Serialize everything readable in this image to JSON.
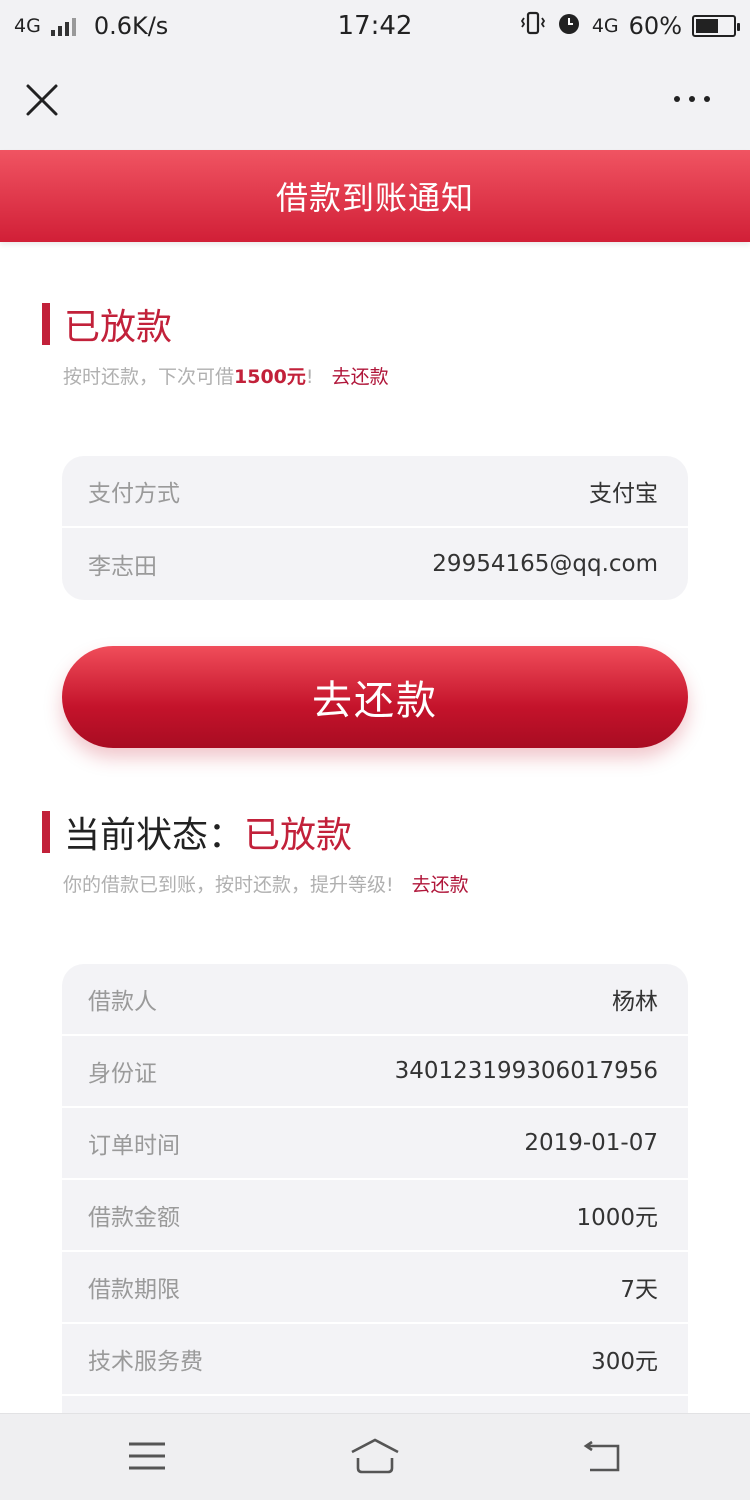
{
  "status_bar": {
    "network": "4G",
    "speed": "0.6K/s",
    "time": "17:42",
    "network_right": "4G",
    "battery": "60%",
    "battery_level": 0.6
  },
  "banner": {
    "title": "借款到账通知"
  },
  "section1": {
    "title": "已放款",
    "sub_prefix": "按时还款，下次可借",
    "sub_amount": "1500元",
    "sub_suffix": "!",
    "sub_link": "去还款"
  },
  "payment_card": [
    {
      "key": "支付方式",
      "value": "支付宝"
    },
    {
      "key": "李志田",
      "value": "29954165@qq.com"
    }
  ],
  "cta": {
    "label": "去还款"
  },
  "section2": {
    "label": "当前状态：",
    "status": "已放款",
    "sub_text": "你的借款已到账，按时还款，提升等级!",
    "sub_link": "去还款"
  },
  "loan_card": [
    {
      "key": "借款人",
      "value": "杨林"
    },
    {
      "key": "身份证",
      "value": "340123199306017956"
    },
    {
      "key": "订单时间",
      "value": "2019-01-07"
    },
    {
      "key": "借款金额",
      "value": "1000元"
    },
    {
      "key": "借款期限",
      "value": "7天"
    },
    {
      "key": "技术服务费",
      "value": "300元"
    }
  ],
  "icons": {
    "close": "close-icon",
    "more": "more-icon",
    "menu": "menu-icon",
    "home": "home-icon",
    "back": "back-icon"
  },
  "colors": {
    "accent": "#c2213a",
    "banner_top": "#f05462",
    "banner_bottom": "#d11f37"
  }
}
